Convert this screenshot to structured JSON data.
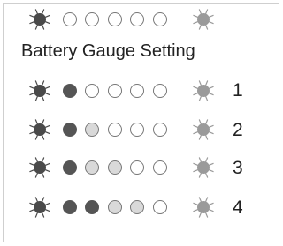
{
  "title": "Battery Gauge Setting",
  "colors": {
    "led_on": "#555555",
    "led_dim": "#d9d9d9",
    "led_off": "#ffffff",
    "led_outline": "#777777",
    "left_indicator": "#4a4a4a",
    "right_indicator": "#9a9a9a",
    "text": "#222222"
  },
  "header_row": {
    "leds": [
      "off",
      "off",
      "off",
      "off",
      "off"
    ]
  },
  "settings": [
    {
      "number": "1",
      "leds": [
        "on",
        "off",
        "off",
        "off",
        "off"
      ]
    },
    {
      "number": "2",
      "leds": [
        "on",
        "dim",
        "off",
        "off",
        "off"
      ]
    },
    {
      "number": "3",
      "leds": [
        "on",
        "dim",
        "dim",
        "off",
        "off"
      ]
    },
    {
      "number": "4",
      "leds": [
        "on",
        "on",
        "dim",
        "dim",
        "off"
      ]
    }
  ]
}
